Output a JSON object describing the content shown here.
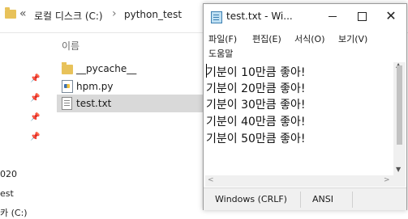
{
  "explorer": {
    "breadcrumb_prefix": "«",
    "breadcrumb": [
      "로컬 디스크 (C:)",
      "python_test"
    ],
    "breadcrumb_sep": "›",
    "column_header": "이름",
    "files": [
      {
        "name": "__pycache__",
        "icon": "folder-icon"
      },
      {
        "name": "hpm.py",
        "icon": "python-file-icon"
      },
      {
        "name": "test.txt",
        "icon": "text-file-icon",
        "selected": true
      }
    ],
    "tree_items": [
      "020",
      "est",
      "카 (C:)"
    ]
  },
  "notepad": {
    "title": "test.txt - Wi...",
    "menu": [
      "파일(F)",
      "편집(E)",
      "서식(O)",
      "보기(V)",
      "도움말"
    ],
    "lines": [
      "기분이 10만큼 좋아!",
      "기분이 20만큼 좋아!",
      "기분이 30만큼 좋아!",
      "기분이 40만큼 좋아!",
      "기분이 50만큼 좋아!"
    ],
    "status": {
      "line_ending": "Windows (CRLF)",
      "encoding": "ANSI"
    }
  },
  "colors": {
    "selected_row": "#d9d9d9",
    "folder": "#e8c25a",
    "statusbar": "#f0f0f0"
  }
}
